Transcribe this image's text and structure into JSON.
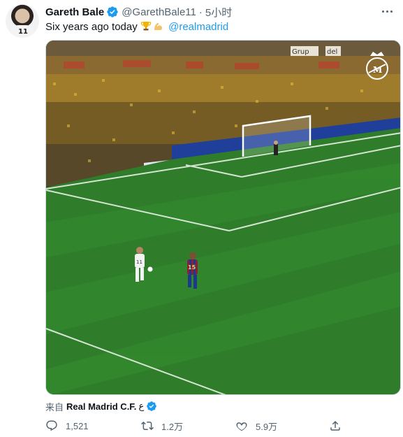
{
  "tweet": {
    "author_name": "Gareth Bale",
    "handle": "@GarethBale11",
    "separator": "·",
    "time": "5小时",
    "text_main": "Six years ago today ",
    "mention": "@realmadrid",
    "avatar_number": "11"
  },
  "media": {
    "player_number": "15",
    "player_number_white": "11",
    "board_text": "Grup",
    "board_text_2": "del"
  },
  "source": {
    "prefix": "来自",
    "name": "Real Madrid C.F.",
    "extra": "ع"
  },
  "actions": {
    "replies": "1,521",
    "retweets": "1.2万",
    "likes": "5.9万"
  },
  "colors": {
    "link": "#1d9bf0",
    "secondary_text": "#536471",
    "pitch_green": "#2f7d2b"
  },
  "icons": [
    "more-icon",
    "verified-icon",
    "trophy-icon",
    "flexed-biceps-icon",
    "reply-icon",
    "retweet-icon",
    "like-icon",
    "share-icon",
    "real-madrid-crest-icon"
  ]
}
